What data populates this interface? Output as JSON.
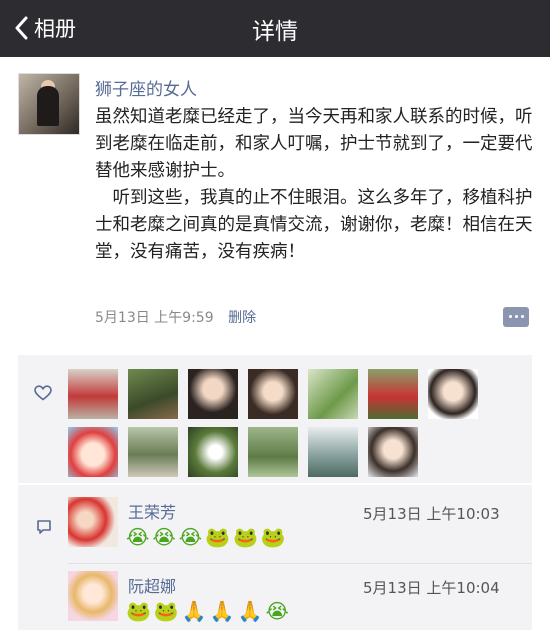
{
  "navbar": {
    "back_label": "相册",
    "title": "详情"
  },
  "post": {
    "username": "狮子座的女人",
    "paragraph1": "虽然知道老糜已经走了，当今天再和家人联系的时候，听到老糜在临走前，和家人叮嘱，护士节就到了，一定要代替他来感谢护士。",
    "paragraph2": "　听到这些，我真的止不住眼泪。这么多年了，移植科护士和老糜之间真的是真情交流，谢谢你，老糜！相信在天堂，没有痛苦，没有疾病！",
    "timestamp": "5月13日 上午9:59",
    "delete_label": "删除"
  },
  "likes": {
    "icon": "heart-icon",
    "count_avatars": 13
  },
  "comments": [
    {
      "name": "王荣芳",
      "time": "5月13日 上午10:03",
      "emojis": "😭😭😭🐸🐸🐸"
    },
    {
      "name": "阮超娜",
      "time": "5月13日 上午10:04",
      "emojis": "🐸🐸🙏🙏🙏😭"
    }
  ],
  "colors": {
    "navbar": "#2d2c31",
    "link": "#576b95",
    "panel": "#f3f3f5"
  }
}
